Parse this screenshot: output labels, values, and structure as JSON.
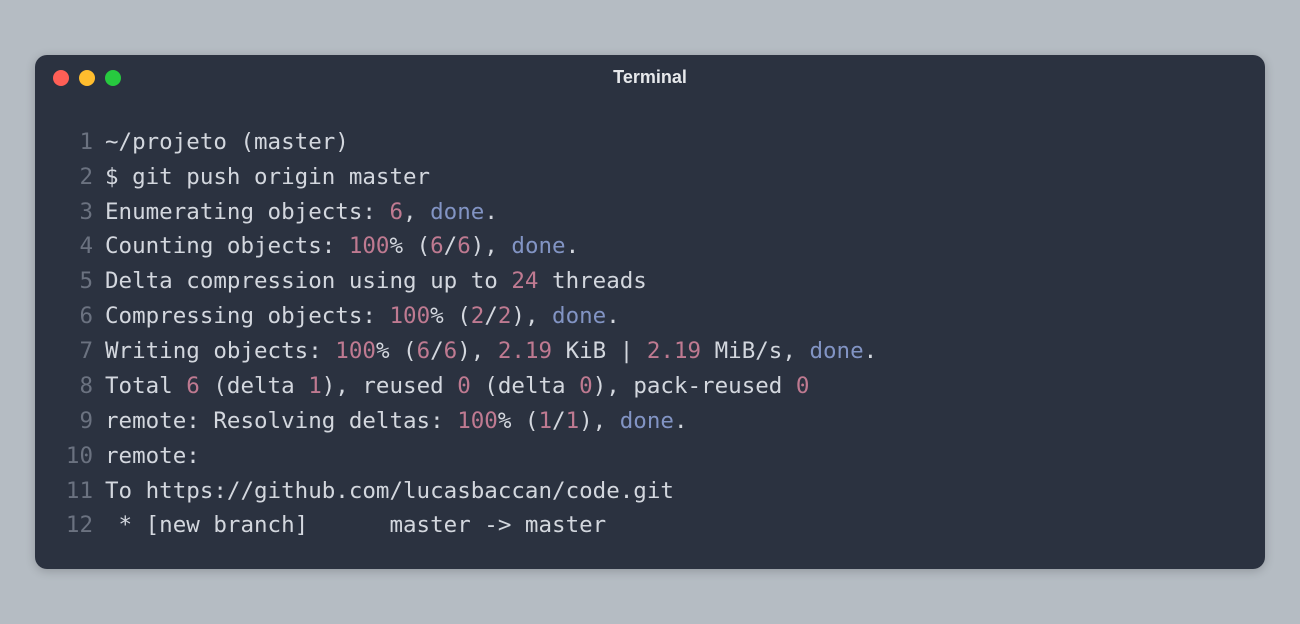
{
  "window": {
    "title": "Terminal",
    "traffic_lights": {
      "close": "#ff5f56",
      "minimize": "#ffbd2e",
      "zoom": "#27c93f"
    }
  },
  "lines": [
    {
      "n": "1",
      "segs": [
        {
          "t": "~/projeto (master)",
          "c": ""
        }
      ]
    },
    {
      "n": "2",
      "segs": [
        {
          "t": "$ git push origin master",
          "c": ""
        }
      ]
    },
    {
      "n": "3",
      "segs": [
        {
          "t": "Enumerating objects: ",
          "c": ""
        },
        {
          "t": "6",
          "c": "tok-num"
        },
        {
          "t": ", ",
          "c": ""
        },
        {
          "t": "done",
          "c": "tok-kw"
        },
        {
          "t": ".",
          "c": ""
        }
      ]
    },
    {
      "n": "4",
      "segs": [
        {
          "t": "Counting objects: ",
          "c": ""
        },
        {
          "t": "100",
          "c": "tok-num"
        },
        {
          "t": "% (",
          "c": ""
        },
        {
          "t": "6",
          "c": "tok-num"
        },
        {
          "t": "/",
          "c": ""
        },
        {
          "t": "6",
          "c": "tok-num"
        },
        {
          "t": "), ",
          "c": ""
        },
        {
          "t": "done",
          "c": "tok-kw"
        },
        {
          "t": ".",
          "c": ""
        }
      ]
    },
    {
      "n": "5",
      "segs": [
        {
          "t": "Delta compression using up to ",
          "c": ""
        },
        {
          "t": "24",
          "c": "tok-num"
        },
        {
          "t": " threads",
          "c": ""
        }
      ]
    },
    {
      "n": "6",
      "segs": [
        {
          "t": "Compressing objects: ",
          "c": ""
        },
        {
          "t": "100",
          "c": "tok-num"
        },
        {
          "t": "% (",
          "c": ""
        },
        {
          "t": "2",
          "c": "tok-num"
        },
        {
          "t": "/",
          "c": ""
        },
        {
          "t": "2",
          "c": "tok-num"
        },
        {
          "t": "), ",
          "c": ""
        },
        {
          "t": "done",
          "c": "tok-kw"
        },
        {
          "t": ".",
          "c": ""
        }
      ]
    },
    {
      "n": "7",
      "segs": [
        {
          "t": "Writing objects: ",
          "c": ""
        },
        {
          "t": "100",
          "c": "tok-num"
        },
        {
          "t": "% (",
          "c": ""
        },
        {
          "t": "6",
          "c": "tok-num"
        },
        {
          "t": "/",
          "c": ""
        },
        {
          "t": "6",
          "c": "tok-num"
        },
        {
          "t": "), ",
          "c": ""
        },
        {
          "t": "2.19",
          "c": "tok-num"
        },
        {
          "t": " KiB | ",
          "c": ""
        },
        {
          "t": "2.19",
          "c": "tok-num"
        },
        {
          "t": " MiB/s, ",
          "c": ""
        },
        {
          "t": "done",
          "c": "tok-kw"
        },
        {
          "t": ".",
          "c": ""
        }
      ]
    },
    {
      "n": "8",
      "segs": [
        {
          "t": "Total ",
          "c": ""
        },
        {
          "t": "6",
          "c": "tok-num"
        },
        {
          "t": " (delta ",
          "c": ""
        },
        {
          "t": "1",
          "c": "tok-num"
        },
        {
          "t": "), reused ",
          "c": ""
        },
        {
          "t": "0",
          "c": "tok-num"
        },
        {
          "t": " (delta ",
          "c": ""
        },
        {
          "t": "0",
          "c": "tok-num"
        },
        {
          "t": "), pack-reused ",
          "c": ""
        },
        {
          "t": "0",
          "c": "tok-num"
        }
      ]
    },
    {
      "n": "9",
      "segs": [
        {
          "t": "remote: Resolving deltas: ",
          "c": ""
        },
        {
          "t": "100",
          "c": "tok-num"
        },
        {
          "t": "% (",
          "c": ""
        },
        {
          "t": "1",
          "c": "tok-num"
        },
        {
          "t": "/",
          "c": ""
        },
        {
          "t": "1",
          "c": "tok-num"
        },
        {
          "t": "), ",
          "c": ""
        },
        {
          "t": "done",
          "c": "tok-kw"
        },
        {
          "t": ".",
          "c": ""
        }
      ]
    },
    {
      "n": "10",
      "segs": [
        {
          "t": "remote:",
          "c": ""
        }
      ]
    },
    {
      "n": "11",
      "segs": [
        {
          "t": "To https://github.com/lucasbaccan/code.git",
          "c": ""
        }
      ]
    },
    {
      "n": "12",
      "segs": [
        {
          "t": " * [new branch]      master -> master",
          "c": ""
        }
      ]
    }
  ]
}
